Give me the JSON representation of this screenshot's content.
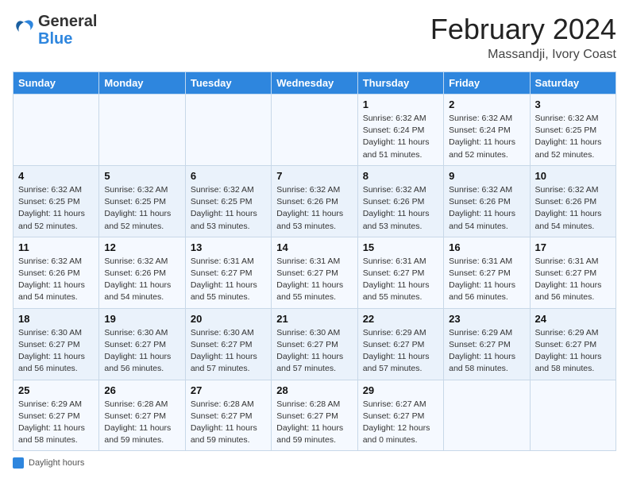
{
  "header": {
    "logo_general": "General",
    "logo_blue": "Blue",
    "month_year": "February 2024",
    "location": "Massandji, Ivory Coast"
  },
  "days_of_week": [
    "Sunday",
    "Monday",
    "Tuesday",
    "Wednesday",
    "Thursday",
    "Friday",
    "Saturday"
  ],
  "weeks": [
    [
      {
        "day": "",
        "sunrise": "",
        "sunset": "",
        "daylight": ""
      },
      {
        "day": "",
        "sunrise": "",
        "sunset": "",
        "daylight": ""
      },
      {
        "day": "",
        "sunrise": "",
        "sunset": "",
        "daylight": ""
      },
      {
        "day": "",
        "sunrise": "",
        "sunset": "",
        "daylight": ""
      },
      {
        "day": "1",
        "sunrise": "Sunrise: 6:32 AM",
        "sunset": "Sunset: 6:24 PM",
        "daylight": "Daylight: 11 hours and 51 minutes."
      },
      {
        "day": "2",
        "sunrise": "Sunrise: 6:32 AM",
        "sunset": "Sunset: 6:24 PM",
        "daylight": "Daylight: 11 hours and 52 minutes."
      },
      {
        "day": "3",
        "sunrise": "Sunrise: 6:32 AM",
        "sunset": "Sunset: 6:25 PM",
        "daylight": "Daylight: 11 hours and 52 minutes."
      }
    ],
    [
      {
        "day": "4",
        "sunrise": "Sunrise: 6:32 AM",
        "sunset": "Sunset: 6:25 PM",
        "daylight": "Daylight: 11 hours and 52 minutes."
      },
      {
        "day": "5",
        "sunrise": "Sunrise: 6:32 AM",
        "sunset": "Sunset: 6:25 PM",
        "daylight": "Daylight: 11 hours and 52 minutes."
      },
      {
        "day": "6",
        "sunrise": "Sunrise: 6:32 AM",
        "sunset": "Sunset: 6:25 PM",
        "daylight": "Daylight: 11 hours and 53 minutes."
      },
      {
        "day": "7",
        "sunrise": "Sunrise: 6:32 AM",
        "sunset": "Sunset: 6:26 PM",
        "daylight": "Daylight: 11 hours and 53 minutes."
      },
      {
        "day": "8",
        "sunrise": "Sunrise: 6:32 AM",
        "sunset": "Sunset: 6:26 PM",
        "daylight": "Daylight: 11 hours and 53 minutes."
      },
      {
        "day": "9",
        "sunrise": "Sunrise: 6:32 AM",
        "sunset": "Sunset: 6:26 PM",
        "daylight": "Daylight: 11 hours and 54 minutes."
      },
      {
        "day": "10",
        "sunrise": "Sunrise: 6:32 AM",
        "sunset": "Sunset: 6:26 PM",
        "daylight": "Daylight: 11 hours and 54 minutes."
      }
    ],
    [
      {
        "day": "11",
        "sunrise": "Sunrise: 6:32 AM",
        "sunset": "Sunset: 6:26 PM",
        "daylight": "Daylight: 11 hours and 54 minutes."
      },
      {
        "day": "12",
        "sunrise": "Sunrise: 6:32 AM",
        "sunset": "Sunset: 6:26 PM",
        "daylight": "Daylight: 11 hours and 54 minutes."
      },
      {
        "day": "13",
        "sunrise": "Sunrise: 6:31 AM",
        "sunset": "Sunset: 6:27 PM",
        "daylight": "Daylight: 11 hours and 55 minutes."
      },
      {
        "day": "14",
        "sunrise": "Sunrise: 6:31 AM",
        "sunset": "Sunset: 6:27 PM",
        "daylight": "Daylight: 11 hours and 55 minutes."
      },
      {
        "day": "15",
        "sunrise": "Sunrise: 6:31 AM",
        "sunset": "Sunset: 6:27 PM",
        "daylight": "Daylight: 11 hours and 55 minutes."
      },
      {
        "day": "16",
        "sunrise": "Sunrise: 6:31 AM",
        "sunset": "Sunset: 6:27 PM",
        "daylight": "Daylight: 11 hours and 56 minutes."
      },
      {
        "day": "17",
        "sunrise": "Sunrise: 6:31 AM",
        "sunset": "Sunset: 6:27 PM",
        "daylight": "Daylight: 11 hours and 56 minutes."
      }
    ],
    [
      {
        "day": "18",
        "sunrise": "Sunrise: 6:30 AM",
        "sunset": "Sunset: 6:27 PM",
        "daylight": "Daylight: 11 hours and 56 minutes."
      },
      {
        "day": "19",
        "sunrise": "Sunrise: 6:30 AM",
        "sunset": "Sunset: 6:27 PM",
        "daylight": "Daylight: 11 hours and 56 minutes."
      },
      {
        "day": "20",
        "sunrise": "Sunrise: 6:30 AM",
        "sunset": "Sunset: 6:27 PM",
        "daylight": "Daylight: 11 hours and 57 minutes."
      },
      {
        "day": "21",
        "sunrise": "Sunrise: 6:30 AM",
        "sunset": "Sunset: 6:27 PM",
        "daylight": "Daylight: 11 hours and 57 minutes."
      },
      {
        "day": "22",
        "sunrise": "Sunrise: 6:29 AM",
        "sunset": "Sunset: 6:27 PM",
        "daylight": "Daylight: 11 hours and 57 minutes."
      },
      {
        "day": "23",
        "sunrise": "Sunrise: 6:29 AM",
        "sunset": "Sunset: 6:27 PM",
        "daylight": "Daylight: 11 hours and 58 minutes."
      },
      {
        "day": "24",
        "sunrise": "Sunrise: 6:29 AM",
        "sunset": "Sunset: 6:27 PM",
        "daylight": "Daylight: 11 hours and 58 minutes."
      }
    ],
    [
      {
        "day": "25",
        "sunrise": "Sunrise: 6:29 AM",
        "sunset": "Sunset: 6:27 PM",
        "daylight": "Daylight: 11 hours and 58 minutes."
      },
      {
        "day": "26",
        "sunrise": "Sunrise: 6:28 AM",
        "sunset": "Sunset: 6:27 PM",
        "daylight": "Daylight: 11 hours and 59 minutes."
      },
      {
        "day": "27",
        "sunrise": "Sunrise: 6:28 AM",
        "sunset": "Sunset: 6:27 PM",
        "daylight": "Daylight: 11 hours and 59 minutes."
      },
      {
        "day": "28",
        "sunrise": "Sunrise: 6:28 AM",
        "sunset": "Sunset: 6:27 PM",
        "daylight": "Daylight: 11 hours and 59 minutes."
      },
      {
        "day": "29",
        "sunrise": "Sunrise: 6:27 AM",
        "sunset": "Sunset: 6:27 PM",
        "daylight": "Daylight: 12 hours and 0 minutes."
      },
      {
        "day": "",
        "sunrise": "",
        "sunset": "",
        "daylight": ""
      },
      {
        "day": "",
        "sunrise": "",
        "sunset": "",
        "daylight": ""
      }
    ]
  ],
  "footer": {
    "daylight_label": "Daylight hours"
  }
}
